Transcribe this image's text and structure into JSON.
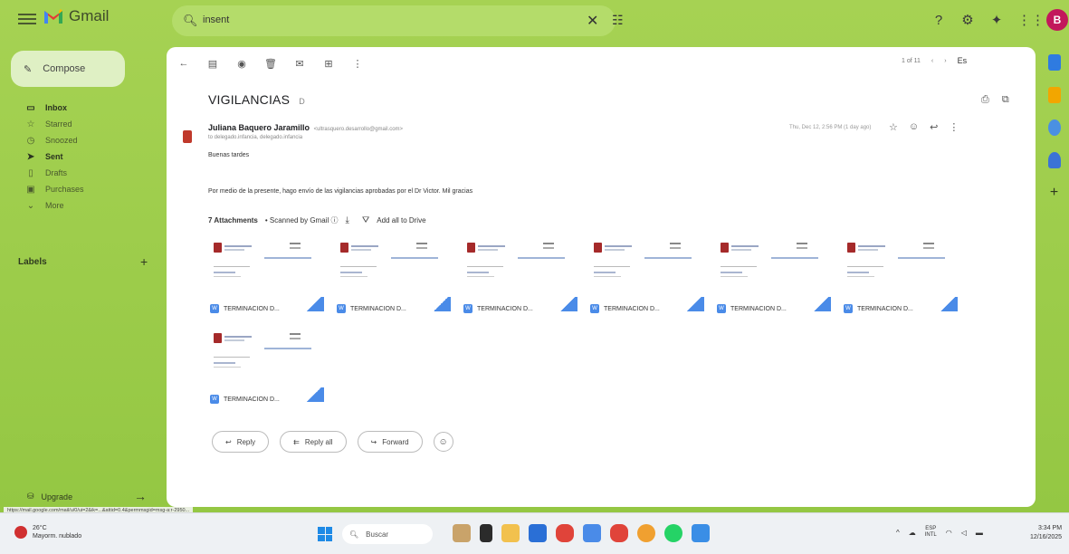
{
  "topbar": {
    "app_name": "Gmail",
    "search_value": "insent",
    "icons": [
      "help-icon",
      "settings-icon",
      "gemini-icon",
      "apps-icon"
    ],
    "avatar_letter": "B"
  },
  "sidebar": {
    "compose_label": "Compose",
    "items": [
      {
        "label": "Inbox",
        "icon": "inbox-icon",
        "count": "",
        "bold": true
      },
      {
        "label": "Starred",
        "icon": "star-icon",
        "count": ""
      },
      {
        "label": "Snoozed",
        "icon": "clock-icon",
        "count": ""
      },
      {
        "label": "Sent",
        "icon": "send-icon",
        "count": "",
        "bold": true
      },
      {
        "label": "Drafts",
        "icon": "draft-icon",
        "count": ""
      },
      {
        "label": "Purchases",
        "icon": "tag-icon",
        "count": ""
      },
      {
        "label": "More",
        "icon": "chevron-down-icon",
        "count": ""
      }
    ],
    "labels_title": "Labels",
    "upgrade_label": "Upgrade"
  },
  "toolbar": {
    "pager_text": "1 of 11",
    "language": "Es"
  },
  "email": {
    "subject": "VIGILANCIAS",
    "subject_tag": "D",
    "sender_name": "Juliana Baquero Jaramillo",
    "sender_email": "<ultrasquero.desarrollo@gmail.com>",
    "to_line": "to delegado.infancia, delegado.infancia",
    "date": "Thu, Dec 12, 2:56 PM (1 day ago)",
    "greeting": "Buenas tardes",
    "body": "Por medio de la presente, hago envío de las vigilancias aprobadas por el Dr Victor. Mil gracias",
    "attachments_title": "7 Attachments",
    "scanned_label": "• Scanned by Gmail ⓘ",
    "add_to_drive": "Add all to Drive",
    "attachments": [
      {
        "name": "TERMINACION D..."
      },
      {
        "name": "TERMINACION D..."
      },
      {
        "name": "TERMINACION D..."
      },
      {
        "name": "TERMINACION D..."
      },
      {
        "name": "TERMINACION D..."
      },
      {
        "name": "TERMINACION D..."
      },
      {
        "name": "TERMINACION D..."
      }
    ],
    "reply_label": "Reply",
    "reply_all_label": "Reply all",
    "forward_label": "Forward"
  },
  "status_url": "https://mail.google.com/mail/u/0/ui=2&ik=...&attid=0.4&permmsgid=msg-a:r-2950...",
  "taskbar": {
    "weather_temp": "26°C",
    "weather_desc": "Mayorm. nublado",
    "search_label": "Buscar",
    "lang_top": "ESP",
    "lang_bottom": "INTL",
    "time": "3:34 PM",
    "date": "12/16/2025"
  },
  "colors": {
    "theme_green": "#9fce4f",
    "accent_blue": "#4a8be8"
  }
}
